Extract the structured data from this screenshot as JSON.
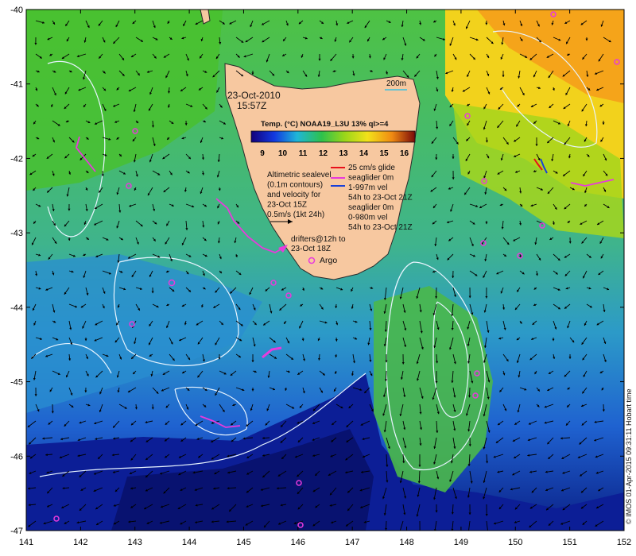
{
  "map": {
    "lon_min": 141,
    "lon_max": 152,
    "lat_min": -47,
    "lat_max": -40,
    "x_ticks": [
      "141",
      "142",
      "143",
      "144",
      "145",
      "146",
      "147",
      "148",
      "149",
      "150",
      "151",
      "152"
    ],
    "y_ticks": [
      "-40",
      "-41",
      "-42",
      "-43",
      "-44",
      "-45",
      "-46",
      "-47"
    ]
  },
  "annotations": {
    "date": "23-Oct-2010",
    "time": "15:57Z",
    "isobath_label": "200m",
    "colorbar_title": "Temp. (°C) NOAA19_L3U 13% ql>=4",
    "colorbar_ticks": [
      "9",
      "10",
      "11",
      "12",
      "13",
      "14",
      "15",
      "16"
    ],
    "altimetry_lines": [
      "Altimetric sealevel",
      "(0.1m contours)",
      "and velocity for",
      "23-Oct 15Z",
      "0.5m/s (1kt 24h)"
    ],
    "glider_lines": [
      "25 cm/s glide",
      "seaglider 0m",
      "1-997m vel",
      "54h to 23-Oct 21Z",
      "seaglider 0m",
      "0-980m vel",
      "54h to 23-Oct 21Z"
    ],
    "drifter_lines": [
      "drifters@12h to",
      "23-Oct 18Z"
    ],
    "argo_label": "Argo",
    "credit": "© IMOS 01-Apr-2015 09:31:11 Hobart time"
  },
  "colors": {
    "land": "#f7c8a0",
    "drifter": "#e83adc",
    "glider_red": "#e8101a",
    "glider_blue": "#1840d8",
    "contour": "#e8f4ff",
    "arrow": "#000000"
  }
}
